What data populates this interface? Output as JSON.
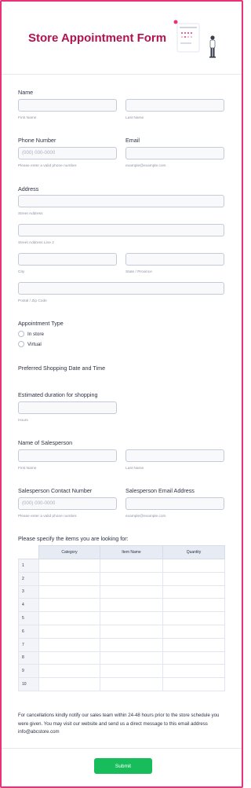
{
  "form": {
    "title": "Store Appointment Form"
  },
  "name": {
    "label": "Name",
    "first_sub": "First Name",
    "last_sub": "Last Name"
  },
  "phone": {
    "label": "Phone Number",
    "placeholder": "(000) 000-0000",
    "sub": "Please enter a valid phone number."
  },
  "email": {
    "label": "Email",
    "sub": "example@example.com"
  },
  "address": {
    "label": "Address",
    "street_sub": "Street Address",
    "street2_sub": "Street Address Line 2",
    "city_sub": "City",
    "state_sub": "State / Province",
    "postal_sub": "Postal / Zip Code"
  },
  "appointment_type": {
    "label": "Appointment Type",
    "options": [
      "In store",
      "Virtual"
    ]
  },
  "preferred_date": {
    "label": "Preferred Shopping Date and Time"
  },
  "duration": {
    "label": "Estimated duration for shopping",
    "sub": "Hours"
  },
  "salesperson": {
    "label": "Name of Salesperson",
    "first_sub": "First Name",
    "last_sub": "Last Name"
  },
  "salesperson_phone": {
    "label": "Salesperson Contact Number",
    "placeholder": "(000) 000-0000",
    "sub": "Please enter a valid phone number."
  },
  "salesperson_email": {
    "label": "Salesperson Email Address",
    "sub": "example@example.com"
  },
  "items": {
    "label": "Please specify the items you are looking for:",
    "columns": [
      "Category",
      "Item Name",
      "Quantity"
    ],
    "rows": [
      "1",
      "2",
      "3",
      "4",
      "5",
      "6",
      "7",
      "8",
      "9",
      "10"
    ]
  },
  "note": "For cancellations kindly notify our sales team within 24-48 hours prior to the store schedule you were given. You may visit our website and send us a direct message to this email address info@abcstore.com",
  "submit_label": "Submit",
  "colors": {
    "frame": "#e8337a",
    "title": "#b3124f",
    "submit": "#18bd5b"
  }
}
